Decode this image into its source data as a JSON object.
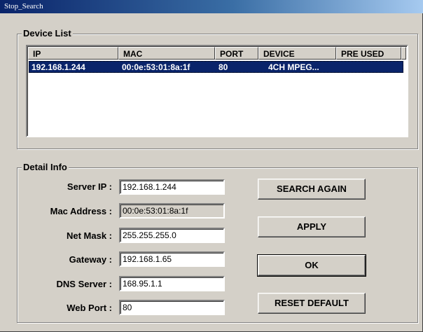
{
  "window": {
    "title": "Stop_Search"
  },
  "device_list": {
    "title": "Device List",
    "columns": [
      "IP",
      "MAC",
      "PORT",
      "DEVICE",
      "PRE USED"
    ],
    "rows": [
      {
        "ip": "192.168.1.244",
        "mac": "00:0e:53:01:8a:1f",
        "port": "80",
        "device": "4CH MPEG...",
        "pre_used": ""
      }
    ]
  },
  "detail_info": {
    "title": "Detail Info",
    "server_ip": {
      "label": "Server IP :",
      "value": "192.168.1.244"
    },
    "mac_address": {
      "label": "Mac Address :",
      "value": "00:0e:53:01:8a:1f"
    },
    "net_mask": {
      "label": "Net Mask :",
      "value": "255.255.255.0"
    },
    "gateway": {
      "label": "Gateway :",
      "value": "192.168.1.65"
    },
    "dns_server": {
      "label": "DNS Server :",
      "value": "168.95.1.1"
    },
    "web_port": {
      "label": "Web Port :",
      "value": "80"
    }
  },
  "buttons": {
    "search_again": "SEARCH AGAIN",
    "apply": "APPLY",
    "ok": "OK",
    "reset_default": "RESET DEFAULT"
  }
}
